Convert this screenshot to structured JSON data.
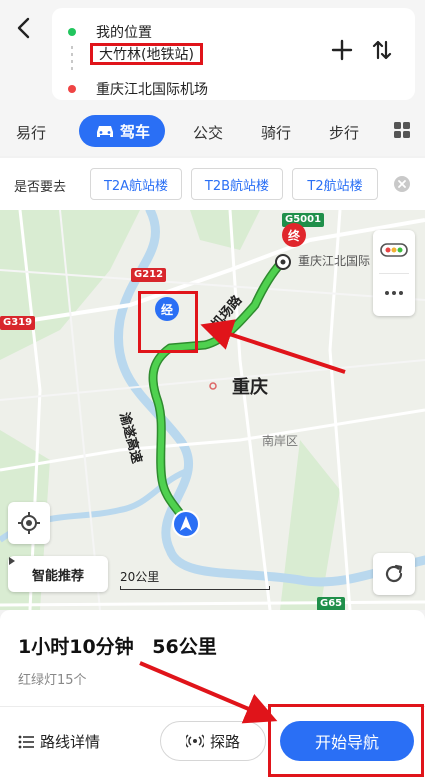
{
  "route": {
    "origin": "我的位置",
    "via": "大竹林(地铁站)",
    "destination": "重庆江北国际机场"
  },
  "tabs": [
    {
      "label": "易行"
    },
    {
      "label": "驾车",
      "active": true
    },
    {
      "label": "公交"
    },
    {
      "label": "骑行"
    },
    {
      "label": "步行"
    }
  ],
  "suggest": {
    "label": "是否要去",
    "chips": [
      "T2A航站楼",
      "T2B航站楼",
      "T2航站楼"
    ]
  },
  "map": {
    "city": "重庆",
    "district": "南岸区",
    "dest_name": "重庆江北国际",
    "road_names": [
      "机场路",
      "渝遂高速"
    ],
    "shields": [
      "G212",
      "G319",
      "G5001",
      "G65"
    ],
    "via_pin": "经",
    "dest_pin": "终",
    "smart_label": "智能推荐",
    "scale": "20公里",
    "route_color": "#3fbf3f",
    "marker_color": "#2a6ff5"
  },
  "summary": {
    "duration": "1小时10分钟",
    "distance": "56公里",
    "lights": "红绿灯15个"
  },
  "actions": {
    "details": "路线详情",
    "explore": "探路",
    "start": "开始导航"
  }
}
